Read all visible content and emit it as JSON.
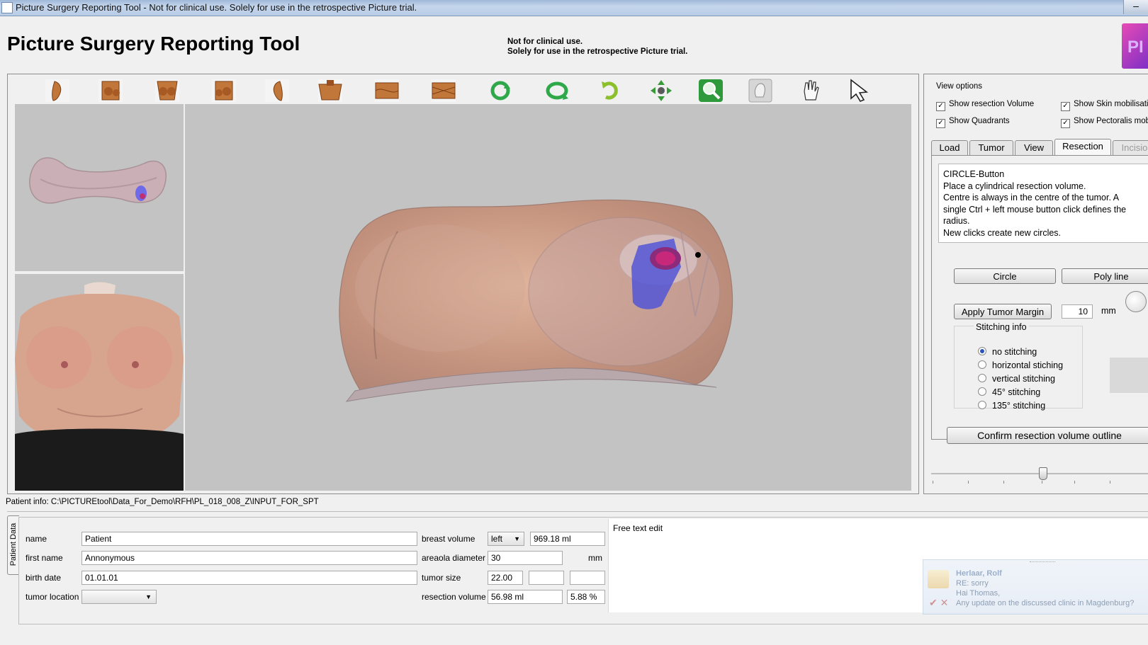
{
  "window": {
    "title": "Picture Surgery Reporting Tool - Not for clinical use. Solely for use in the retrospective Picture trial.",
    "close_glyph": "–"
  },
  "header": {
    "app_title": "Picture Surgery Reporting Tool",
    "notice_line1": "Not for clinical use.",
    "notice_line2": "Solely for use in the retrospective Picture trial.",
    "logo_text": "PI"
  },
  "toolbar": {
    "tools": [
      "view-right-icon",
      "view-right-oblique-icon",
      "view-front-icon",
      "view-left-oblique-icon",
      "view-left-icon",
      "view-top-icon",
      "view-bottom-icon",
      "view-back-icon",
      "rotate-icon",
      "rotate-horizontal-icon",
      "rotate-vertical-icon",
      "pan-icon",
      "zoom-icon",
      "pinch-icon",
      "hand-icon",
      "pointer-icon"
    ]
  },
  "patient_info": {
    "path_label": "Patient info: C:\\PICTUREtool\\Data_For_Demo\\RFH\\PL_018_008_Z\\INPUT_FOR_SPT"
  },
  "view_options": {
    "title": "View options",
    "show_resection_volume": {
      "label": "Show resection Volume",
      "checked": "✓"
    },
    "show_skin_mobilisation": {
      "label": "Show Skin mobilisati",
      "checked": "✓"
    },
    "show_quadrants": {
      "label": "Show Quadrants",
      "checked": "✓"
    },
    "show_pectoralis": {
      "label": "Show Pectoralis mob",
      "checked": "✓"
    }
  },
  "tabs": {
    "load": "Load",
    "tumor": "Tumor",
    "view": "View",
    "resection": "Resection",
    "incision": "Incisio"
  },
  "resection": {
    "description": "CIRCLE-Button\nPlace a cylindrical resection volume.\nCentre is always in the centre of the tumor. A\nsingle Ctrl + left mouse button click defines the\nradius.\nNew clicks create new circles.",
    "circle_button": "Circle",
    "polyline_button": "Poly line",
    "apply_margin_button": "Apply Tumor Margin",
    "margin_value": "10",
    "margin_unit": "mm",
    "stitching_title": "Stitching info",
    "stitching_options": [
      "no stitching",
      "horizontal stiching",
      "vertical stitching",
      "45° stitching",
      "135° stitching"
    ],
    "stitching_selected": "no stitching",
    "confirm_button": "Confirm resection volume outline"
  },
  "patient_data": {
    "tab_label": "Patient Data",
    "name_label": "name",
    "name_value": "Patient",
    "first_name_label": "first name",
    "first_name_value": "Annonymous",
    "birth_date_label": "birth date",
    "birth_date_value": "01.01.01",
    "tumor_location_label": "tumor location",
    "tumor_location_value": "",
    "breast_volume_label": "breast volume",
    "breast_side": "left",
    "breast_volume_value": "969.18 ml",
    "areola_label": "areaola diameter",
    "areola_value": "30",
    "areola_unit": "mm",
    "tumor_size_label": "tumor size",
    "tumor_size_value": "22.00",
    "tumor_size_value2": "",
    "tumor_size_value3": "",
    "resection_volume_label": "resection volume",
    "resection_volume_value": "56.98 ml",
    "resection_percent": "5.88 %",
    "free_text_label": "Free text edit"
  },
  "notification": {
    "from": "Herlaar, Rolf",
    "subject": "RE: sorry",
    "greeting": "Hai Thomas,",
    "body": "Any update on the discussed clinic in Magdenburg?",
    "actions": "✔ ✕"
  },
  "colors": {
    "viewport_bg": "#c3c3c3",
    "skin": "#c39a84",
    "resection_cylinder": "#4a5fd8",
    "tumor": "#c8287a",
    "logo": "#e84bb5"
  }
}
